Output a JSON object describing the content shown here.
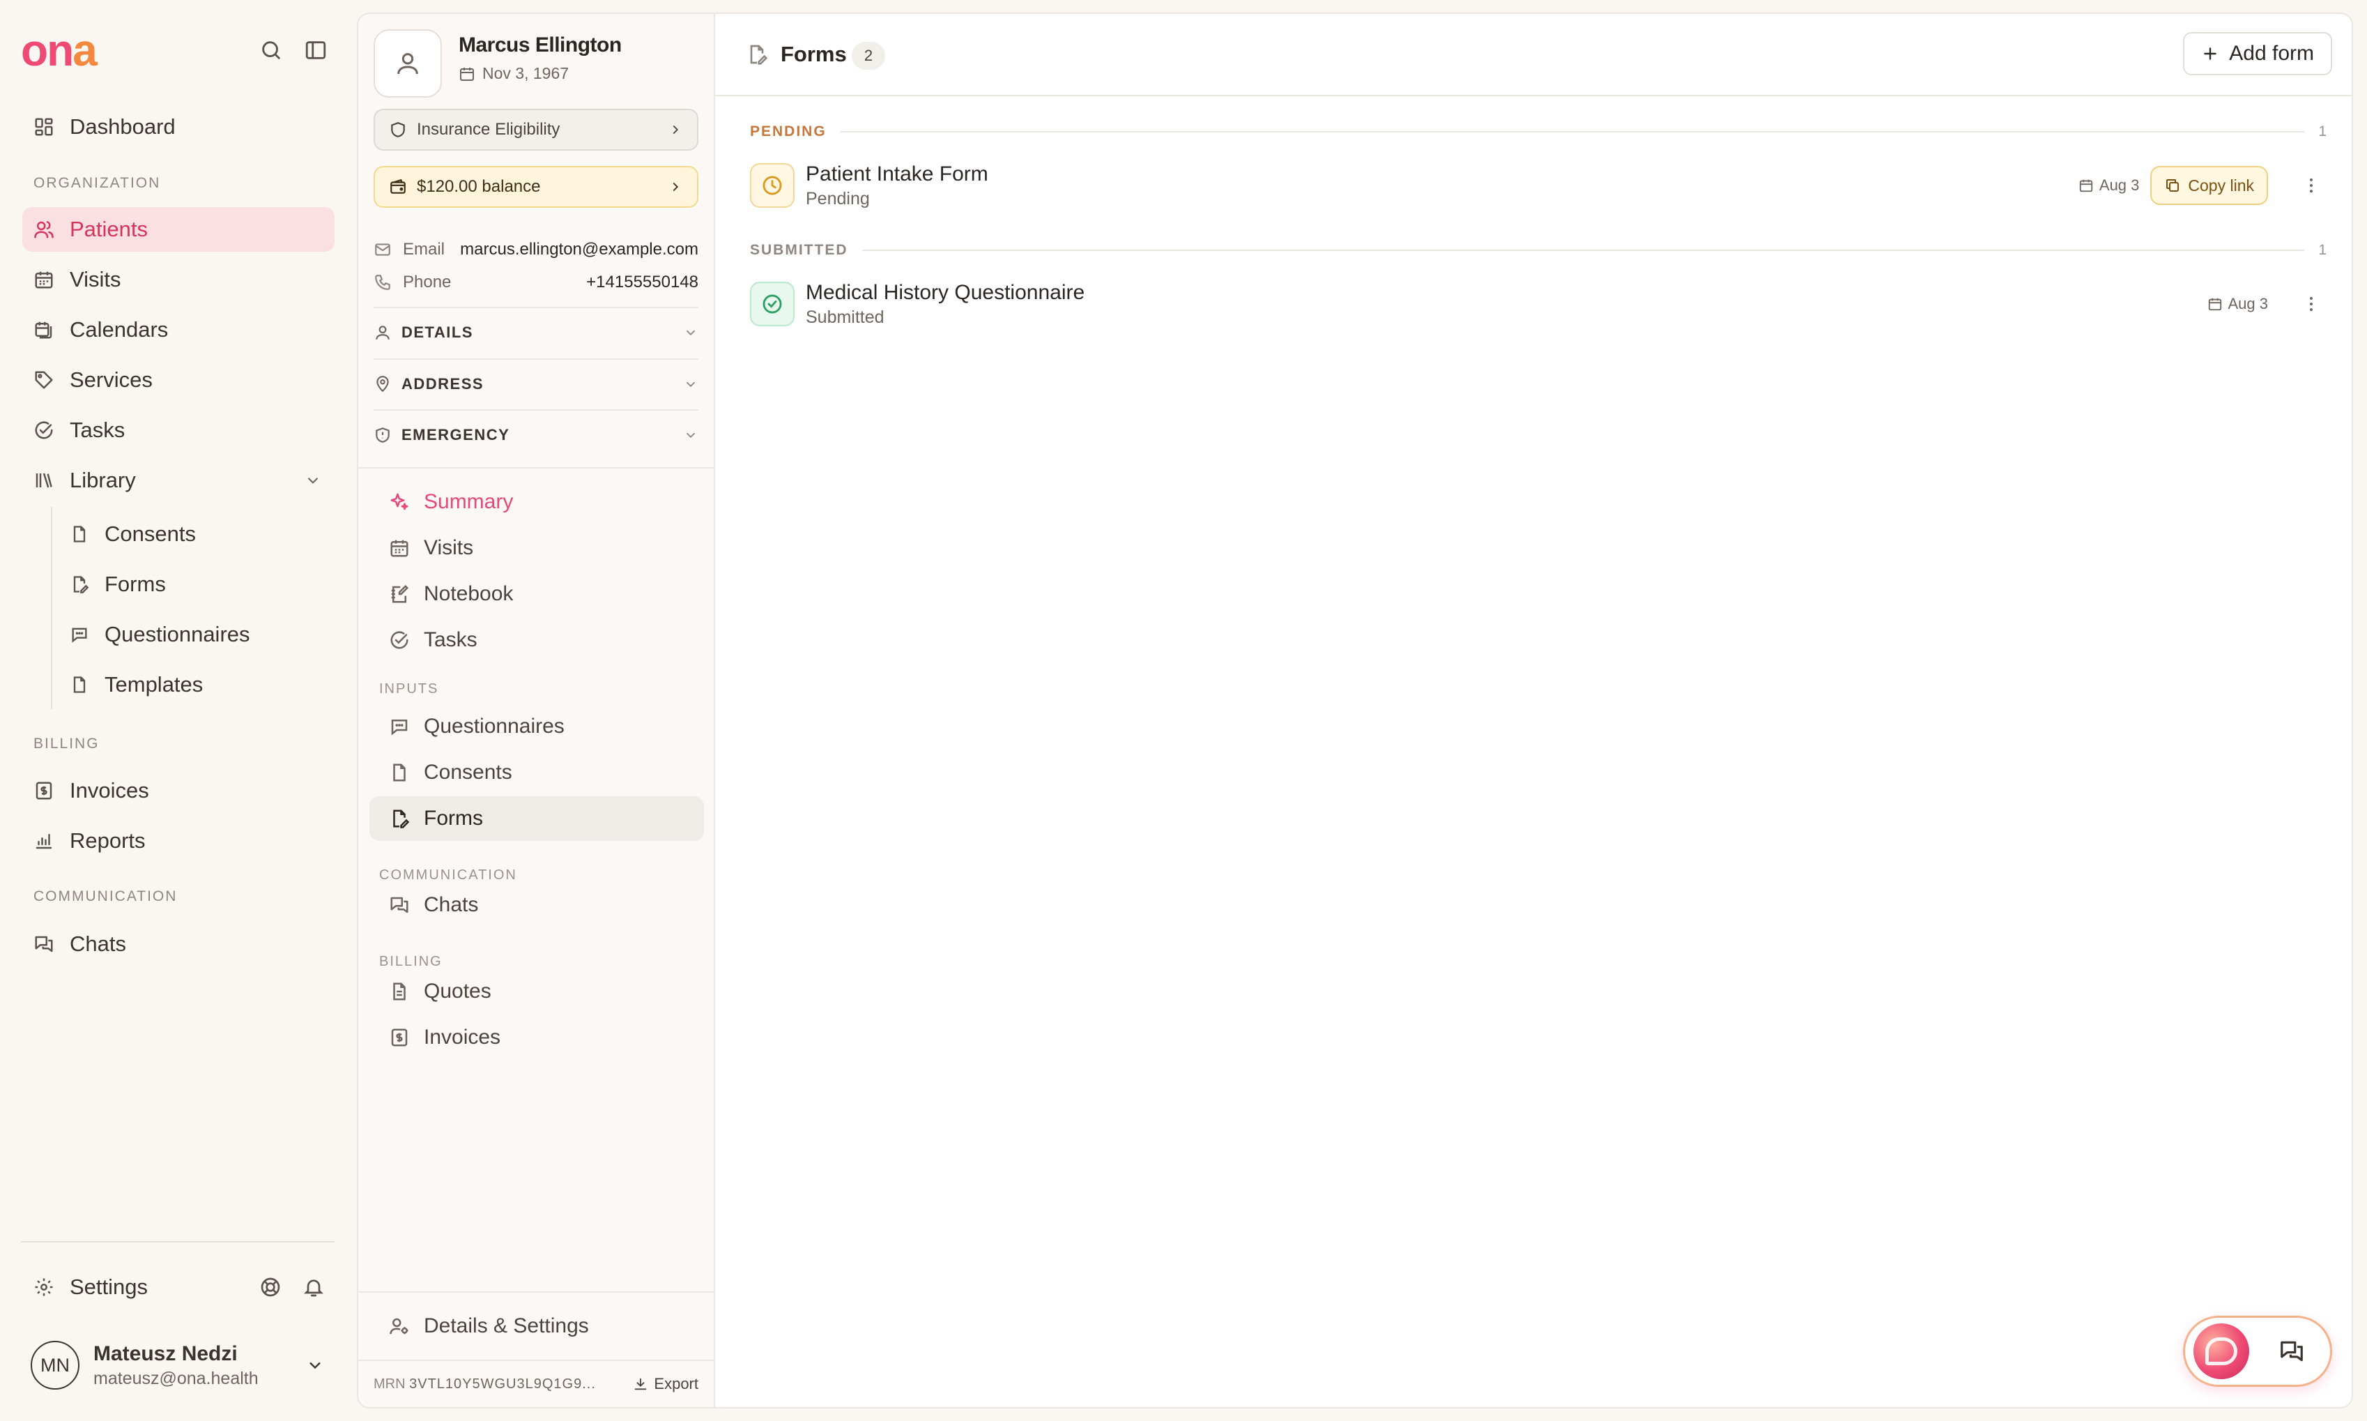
{
  "app": {
    "logo": "ona"
  },
  "sidebar": {
    "dashboard": "Dashboard",
    "org_label": "ORGANIZATION",
    "patients": "Patients",
    "visits": "Visits",
    "calendars": "Calendars",
    "services": "Services",
    "tasks": "Tasks",
    "library": "Library",
    "library_items": [
      "Consents",
      "Forms",
      "Questionnaires",
      "Templates"
    ],
    "billing_label": "BILLING",
    "invoices": "Invoices",
    "reports": "Reports",
    "communication_label": "COMMUNICATION",
    "chats": "Chats",
    "settings": "Settings",
    "user": {
      "initials": "MN",
      "name": "Mateusz Nedzi",
      "email": "mateusz@ona.health"
    }
  },
  "patient": {
    "name": "Marcus Ellington",
    "dob": "Nov 3, 1967",
    "insurance": "Insurance Eligibility",
    "balance": "$120.00 balance",
    "email_label": "Email",
    "email": "marcus.ellington@example.com",
    "phone_label": "Phone",
    "phone": "+14155550148",
    "sections": [
      "DETAILS",
      "ADDRESS",
      "EMERGENCY"
    ],
    "nav": {
      "summary": "Summary",
      "visits": "Visits",
      "notebook": "Notebook",
      "tasks": "Tasks",
      "inputs_label": "INPUTS",
      "questionnaires": "Questionnaires",
      "consents": "Consents",
      "forms": "Forms",
      "communication_label": "COMMUNICATION",
      "chats": "Chats",
      "billing_label": "BILLING",
      "quotes": "Quotes",
      "invoices": "Invoices",
      "details_settings": "Details & Settings"
    },
    "mrn_label": "MRN",
    "mrn": "3VTL10Y5WGU3L9Q1G9...",
    "export": "Export"
  },
  "main": {
    "title": "Forms",
    "count": "2",
    "add_button": "Add form",
    "groups": [
      {
        "label": "PENDING",
        "count": "1",
        "items": [
          {
            "title": "Patient Intake Form",
            "status": "Pending",
            "date": "Aug 3",
            "action": "Copy link"
          }
        ]
      },
      {
        "label": "SUBMITTED",
        "count": "1",
        "items": [
          {
            "title": "Medical History Questionnaire",
            "status": "Submitted",
            "date": "Aug 3"
          }
        ]
      }
    ]
  },
  "colors": {
    "brand_pink": "#ee4a73",
    "brand_orange": "#f5883f",
    "active_bg": "#fbe0e3",
    "pending": "#d99a1d",
    "submitted": "#2a9f63"
  }
}
